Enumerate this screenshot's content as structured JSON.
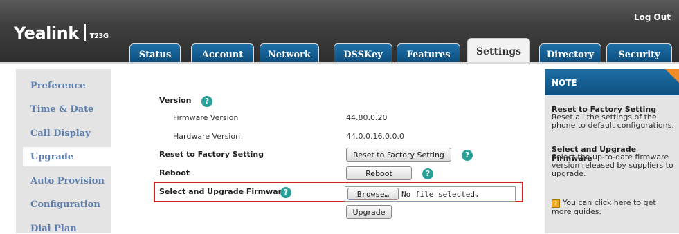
{
  "header": {
    "logo_text": "Yealink",
    "logo_model": "T23G",
    "logout_label": "Log Out",
    "tabs": [
      {
        "label": "Status",
        "active": false
      },
      {
        "label": "Account",
        "active": false
      },
      {
        "label": "Network",
        "active": false
      },
      {
        "label": "DSSKey",
        "active": false
      },
      {
        "label": "Features",
        "active": false
      },
      {
        "label": "Settings",
        "active": true
      },
      {
        "label": "Directory",
        "active": false
      },
      {
        "label": "Security",
        "active": false
      }
    ]
  },
  "sidebar": {
    "items": [
      {
        "label": "Preference"
      },
      {
        "label": "Time & Date"
      },
      {
        "label": "Call Display"
      },
      {
        "label": "Upgrade",
        "active": true
      },
      {
        "label": "Auto Provision"
      },
      {
        "label": "Configuration"
      },
      {
        "label": "Dial Plan"
      }
    ]
  },
  "main": {
    "version_label": "Version",
    "firmware_version_label": "Firmware Version",
    "firmware_version_value": "44.80.0.20",
    "hardware_version_label": "Hardware Version",
    "hardware_version_value": "44.0.0.16.0.0.0",
    "reset_label": "Reset to Factory Setting",
    "reset_button": "Reset to Factory Setting",
    "reboot_label": "Reboot",
    "reboot_button": "Reboot",
    "upgrade_fw_label": "Select and Upgrade Firmware",
    "browse_button": "Browse…",
    "file_status": "No file selected.",
    "upgrade_button": "Upgrade",
    "help_glyph": "?"
  },
  "note": {
    "title": "NOTE",
    "reset_heading": "Reset to Factory Setting",
    "reset_text": "Reset all the settings of the phone to default configurations.",
    "upgrade_heading": "Select and Upgrade Firmware",
    "upgrade_text": "Select the up-to-date firmware version released by suppliers to upgrade.",
    "guide_text": "You can click here to get more guides."
  },
  "colors": {
    "tab_blue": "#0d4f80",
    "sidebar_text": "#5f7fae",
    "note_corner": "#f28c28",
    "highlight": "#d02020",
    "help_icon": "#2aa198"
  }
}
